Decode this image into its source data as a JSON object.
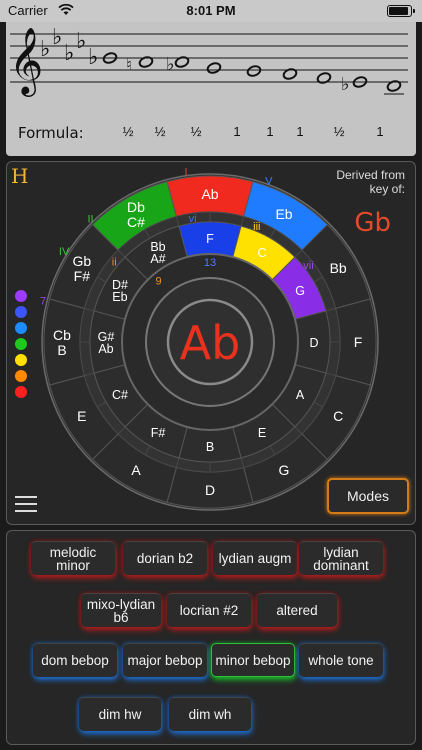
{
  "status_bar": {
    "carrier": "Carrier",
    "time": "8:01 PM"
  },
  "staff": {
    "formula_label": "Formula:",
    "steps": [
      "½",
      "½",
      "½",
      "1",
      "1",
      "1",
      "½",
      "1"
    ]
  },
  "wheel": {
    "corner_label": "H",
    "derived_line1": "Derived from",
    "derived_line2": "key of:",
    "derived_key": "Gb",
    "center_note": "Ab",
    "outer_notes": [
      {
        "label": "Ab",
        "angle": 0
      },
      {
        "label": "Eb",
        "angle": 30
      },
      {
        "label": "Bb",
        "angle": 60
      },
      {
        "label": "F",
        "angle": 90
      },
      {
        "label": "C",
        "angle": 120
      },
      {
        "label": "G",
        "angle": 150
      },
      {
        "label": "D",
        "angle": 180
      },
      {
        "label": "A",
        "angle": 210
      },
      {
        "label": "E",
        "angle": 240
      },
      {
        "label": "Cb\nB",
        "angle": 270
      },
      {
        "label": "Gb\nF#",
        "angle": 300
      },
      {
        "label": "Db\nC#",
        "angle": 330
      }
    ],
    "inner_notes": [
      {
        "label": "F",
        "angle": 0
      },
      {
        "label": "C",
        "angle": 30
      },
      {
        "label": "G",
        "angle": 60
      },
      {
        "label": "D",
        "angle": 90
      },
      {
        "label": "A",
        "angle": 120
      },
      {
        "label": "E",
        "angle": 150
      },
      {
        "label": "B",
        "angle": 180
      },
      {
        "label": "F#",
        "angle": 210
      },
      {
        "label": "C#",
        "angle": 240
      },
      {
        "label": "G#\nAb",
        "angle": 270
      },
      {
        "label": "D#\nEb",
        "angle": 300
      },
      {
        "label": "Bb\nA#",
        "angle": 330
      }
    ],
    "degree_labels": [
      {
        "label": "I",
        "angle": 352,
        "ring": "outer"
      },
      {
        "label": "V",
        "angle": 20,
        "ring": "outer"
      },
      {
        "label": "II",
        "angle": 316,
        "ring": "outer"
      },
      {
        "label": "IV",
        "angle": 302,
        "ring": "outer"
      },
      {
        "label": "7",
        "angle": 284,
        "ring": "outer"
      },
      {
        "label": "vi",
        "angle": 352,
        "ring": "inner"
      },
      {
        "label": "iii",
        "angle": 22,
        "ring": "inner"
      },
      {
        "label": "ii",
        "angle": 310,
        "ring": "inner"
      },
      {
        "label": "vii",
        "angle": 52,
        "ring": "inner"
      },
      {
        "label": "13",
        "angle": 0,
        "ring": "inner2"
      },
      {
        "label": "9",
        "angle": 320,
        "ring": "inner2"
      }
    ],
    "modes_label": "Modes"
  },
  "scales": {
    "row1": [
      "melodic minor",
      "dorian b2",
      "lydian augm",
      "lydian dominant"
    ],
    "row2": [
      "mixo-lydian b6",
      "locrian #2",
      "altered"
    ],
    "row3": [
      "dom bebop",
      "major bebop",
      "minor bebop",
      "whole tone"
    ],
    "row4": [
      "dim hw",
      "dim wh"
    ]
  }
}
